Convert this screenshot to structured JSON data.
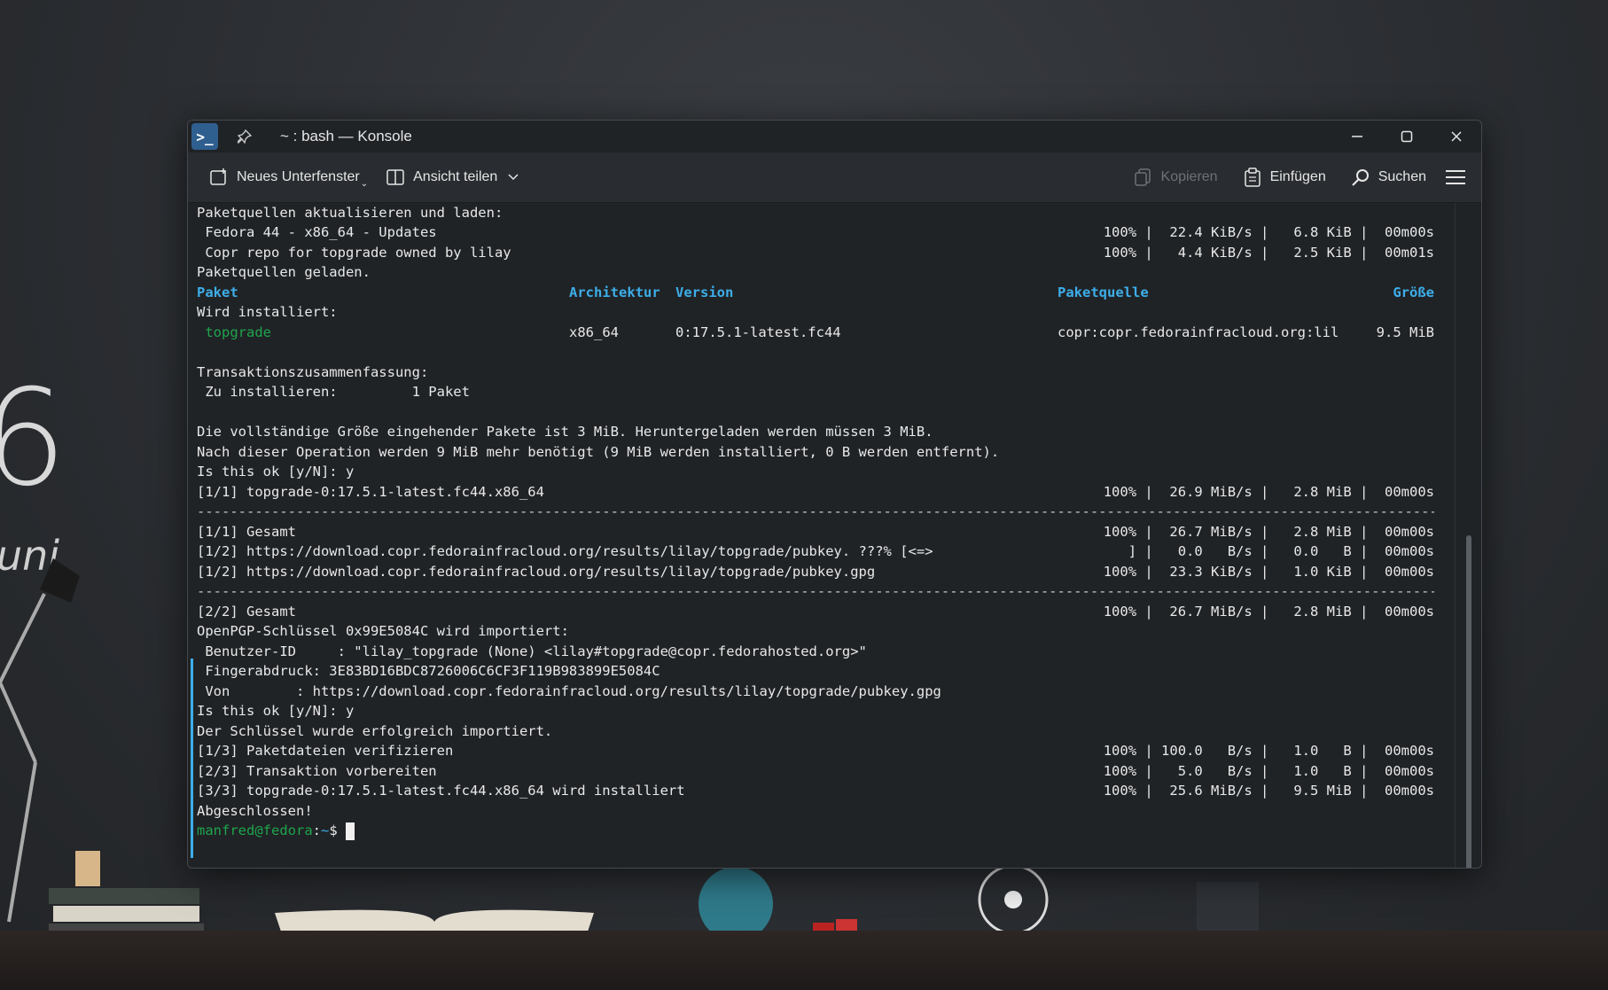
{
  "desktop": {
    "wall_big_text": "6",
    "wall_small_text": "uni"
  },
  "window": {
    "title": "~ : bash — Konsole",
    "app_icon_glyph": ">_",
    "controls": {
      "minimize": "–",
      "maximize": "▢",
      "close": "✕"
    }
  },
  "toolbar": {
    "new_tab_label": "Neues Unterfenster",
    "split_view_label": "Ansicht teilen",
    "copy_label": "Kopieren",
    "paste_label": "Einfügen",
    "find_label": "Suchen"
  },
  "terminal": {
    "lines": {
      "l1": "Paketquellen aktualisieren und laden:",
      "l2": " Fedora 44 - x86_64 - Updates",
      "l2r": "100% |  22.4 KiB/s |   6.8 KiB |  00m00s",
      "l3": " Copr repo for topgrade owned by lilay",
      "l3r": "100% |   4.4 KiB/s |   2.5 KiB |  00m01s",
      "l4": "Paketquellen geladen.",
      "h_paket": "Paket",
      "h_arch": "Architektur",
      "h_version": "Version",
      "h_quelle": "Paketquelle",
      "h_groesse": "Größe",
      "l6": "Wird installiert:",
      "pkg_name": " topgrade",
      "pkg_arch": "x86_64",
      "pkg_version": "0:17.5.1-latest.fc44",
      "pkg_repo": "copr:copr.fedorainfracloud.org:lil",
      "pkg_size": "9.5 MiB",
      "l9": "Transaktionszusammenfassung:",
      "l10": " Zu installieren:         1 Paket",
      "l12": "Die vollständige Größe eingehender Pakete ist 3 MiB. Heruntergeladen werden müssen 3 MiB.",
      "l13": "Nach dieser Operation werden 9 MiB mehr benötigt (9 MiB werden installiert, 0 B werden entfernt).",
      "l14": "Is this ok [y/N]: y",
      "l15": "[1/1] topgrade-0:17.5.1-latest.fc44.x86_64",
      "l15r": "100% |  26.9 MiB/s |   2.8 MiB |  00m00s",
      "separator": "------------------------------------------------------------------------------------------------------------------------------------------------------------------------",
      "l17": "[1/1] Gesamt",
      "l17r": "100% |  26.7 MiB/s |   2.8 MiB |  00m00s",
      "l18": "[1/2] https://download.copr.fedorainfracloud.org/results/lilay/topgrade/pubkey. ???% [<=>",
      "l18r": "] |   0.0   B/s |   0.0   B |  00m00s",
      "l19": "[1/2] https://download.copr.fedorainfracloud.org/results/lilay/topgrade/pubkey.gpg",
      "l19r": "100% |  23.3 KiB/s |   1.0 KiB |  00m00s",
      "l21": "[2/2] Gesamt",
      "l21r": "100% |  26.7 MiB/s |   2.8 MiB |  00m00s",
      "l22": "OpenPGP-Schlüssel 0x99E5084C wird importiert:",
      "l23": " Benutzer-ID     : \"lilay_topgrade (None) <lilay#topgrade@copr.fedorahosted.org>\"",
      "l24": " Fingerabdruck: 3E83BD16BDC8726006C6CF3F119B983899E5084C",
      "l25": " Von        : https://download.copr.fedorainfracloud.org/results/lilay/topgrade/pubkey.gpg",
      "l26": "Is this ok [y/N]: y",
      "l27": "Der Schlüssel wurde erfolgreich importiert.",
      "l28": "[1/3] Paketdateien verifizieren",
      "l28r": "100% | 100.0   B/s |   1.0   B |  00m00s",
      "l29": "[2/3] Transaktion vorbereiten",
      "l29r": "100% |   5.0   B/s |   1.0   B |  00m00s",
      "l30": "[3/3] topgrade-0:17.5.1-latest.fc44.x86_64 wird installiert",
      "l30r": "100% |  25.6 MiB/s |   9.5 MiB |  00m00s",
      "l31": "Abgeschlossen!",
      "prompt_user": "manfred@fedora",
      "prompt_sep": ":",
      "prompt_path": "~",
      "prompt_symbol": "$ "
    }
  }
}
